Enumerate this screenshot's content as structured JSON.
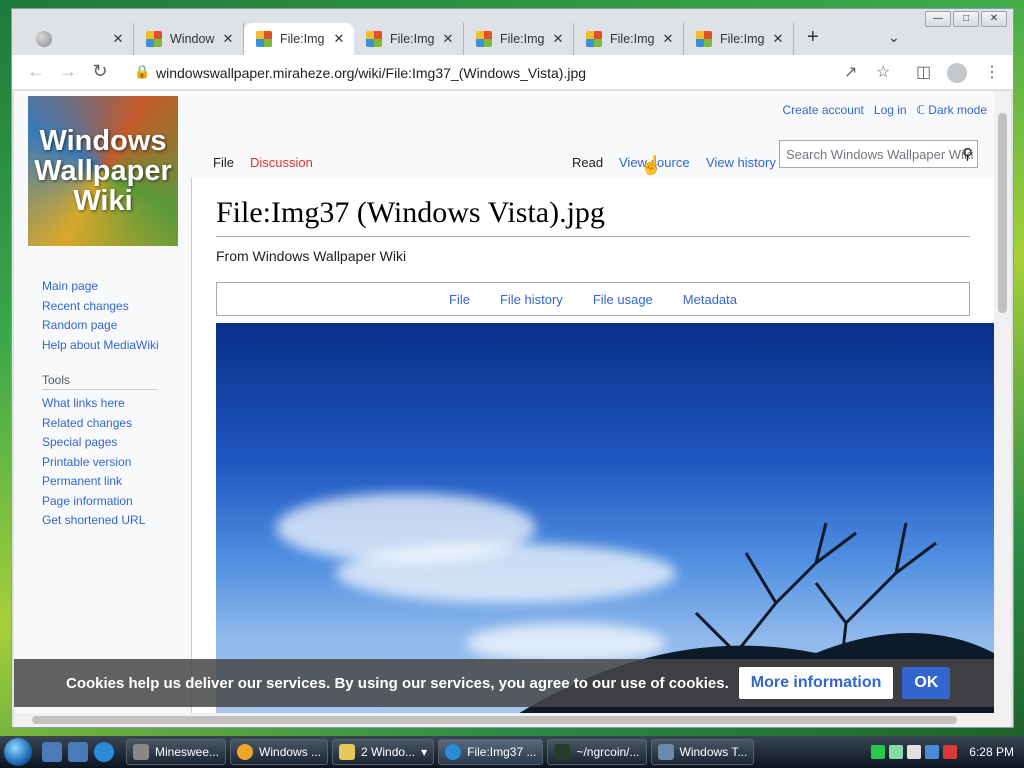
{
  "browser": {
    "tabs": [
      {
        "label": "",
        "favicon": "globe"
      },
      {
        "label": "Window",
        "favicon": "wiki"
      },
      {
        "label": "File:Img",
        "favicon": "wiki",
        "active": true
      },
      {
        "label": "File:Img",
        "favicon": "wiki"
      },
      {
        "label": "File:Img",
        "favicon": "wiki"
      },
      {
        "label": "File:Img",
        "favicon": "wiki"
      },
      {
        "label": "File:Img",
        "favicon": "wiki"
      }
    ],
    "url": "windowswallpaper.miraheze.org/wiki/File:Img37_(Windows_Vista).jpg",
    "icons": {
      "back": "back-arrow-icon",
      "forward": "forward-arrow-icon",
      "reload": "reload-icon",
      "lock": "lock-icon",
      "share": "share-icon",
      "bookmark": "star-icon",
      "sidepanel": "side-panel-icon",
      "profile": "profile-icon",
      "menu": "kebab-menu-icon"
    }
  },
  "wiki": {
    "logo_text": "Windows Wallpaper Wiki",
    "personal": {
      "create_account": "Create account",
      "log_in": "Log in",
      "dark_mode": "ℂ Dark mode"
    },
    "namespace_tabs": {
      "file": "File",
      "discussion": "Discussion"
    },
    "view_tabs": {
      "read": "Read",
      "view_source": "View source",
      "view_history": "View history"
    },
    "search_placeholder": "Search Windows Wallpaper Wiki",
    "title": "File:Img37 (Windows Vista).jpg",
    "tagline": "From Windows Wallpaper Wiki",
    "file_toc": [
      "File",
      "File history",
      "File usage",
      "Metadata"
    ],
    "navigation": [
      "Main page",
      "Recent changes",
      "Random page",
      "Help about MediaWiki"
    ],
    "tools_heading": "Tools",
    "tools": [
      "What links here",
      "Related changes",
      "Special pages",
      "Printable version",
      "Permanent link",
      "Page information",
      "Get shortened URL"
    ]
  },
  "cookie_banner": {
    "text": "Cookies help us deliver our services. By using our services, you agree to our use of cookies.",
    "more_info": "More information",
    "ok": "OK"
  },
  "taskbar": {
    "items": [
      {
        "label": "Mineswee...",
        "icon": "minesweeper-icon"
      },
      {
        "label": "Windows ...",
        "icon": "chrome-icon"
      },
      {
        "label": "2 Windo...",
        "icon": "folder-icon"
      },
      {
        "label": "File:Img37 ...",
        "icon": "chrome-icon",
        "active": true
      },
      {
        "label": "~/ngrcoin/...",
        "icon": "terminal-icon"
      },
      {
        "label": "Windows T...",
        "icon": "task-manager-icon"
      }
    ],
    "clock": "6:28 PM"
  },
  "colors": {
    "link": "#3366cc",
    "new_link": "#dd3333",
    "cookie_ok": "#3366cc"
  }
}
